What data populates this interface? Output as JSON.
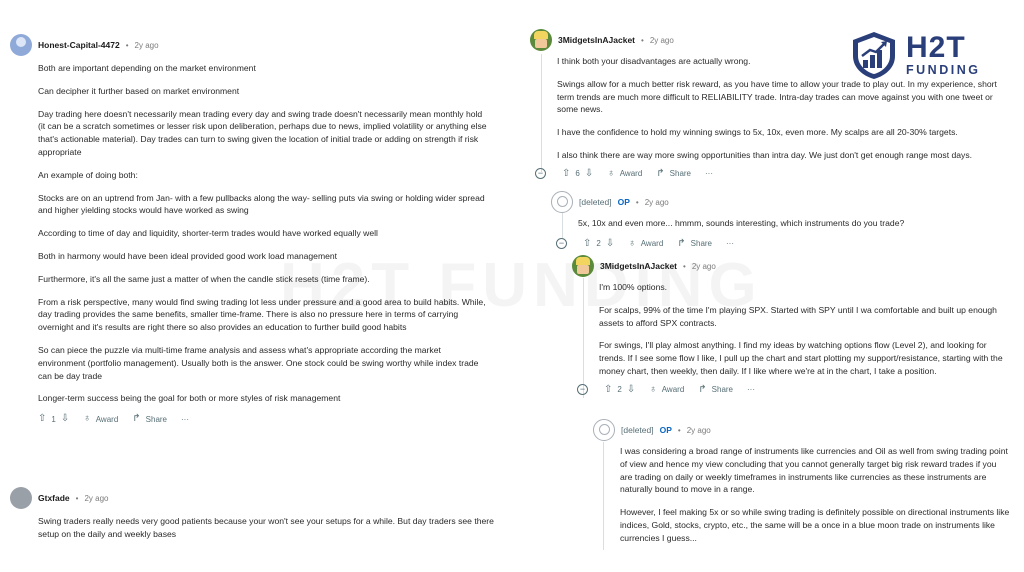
{
  "watermark": "H2T FUNDING",
  "logo": {
    "main": "H2T",
    "sub": "FUNDING"
  },
  "actions": {
    "award": "Award",
    "share": "Share",
    "more": "···"
  },
  "c1": {
    "author": "Honest-Capital-4472",
    "age": "2y ago",
    "paragraphs": [
      "Both are important depending on the market environment",
      "Can decipher it further based on market environment",
      "Day trading here doesn't necessarily mean trading every day and swing trade doesn't necessarily mean monthly hold (it can be a scratch sometimes or lesser risk upon deliberation, perhaps due to news, implied volatility or anything else that's actionable material). Day trades can turn to swing given the location of initial trade or adding on strength if risk appropriate",
      "An example of doing both:",
      "Stocks are on an uptrend from Jan- with a few pullbacks along the way- selling puts via swing or holding wider spread and higher yielding stocks would have worked as swing",
      "According to time of day and liquidity, shorter-term trades would have worked equally well",
      "Both in harmony would have been ideal provided good work load management",
      "Furthermore, it's all the same just a matter of when the candle stick resets (time frame).",
      "From a risk perspective, many would find swing trading lot less under pressure and a good area to build habits. While, day trading provides the same benefits, smaller time-frame. There is also no pressure here in terms of carrying overnight and it's results are right there so also provides an education to further build good habits",
      "So can piece the puzzle via multi-time frame analysis and assess what's appropriate according the market environment (portfolio management). Usually both is the answer. One stock could be swing worthy while index trade can be day trade",
      "Longer-term success being the goal for both or more styles of risk management"
    ],
    "votes": "1"
  },
  "c2": {
    "author": "Gtxfade",
    "age": "2y ago",
    "paragraphs": [
      "Swing traders really needs very good patients because your won't see your setups for a while. But day traders see there setup on the daily and weekly bases"
    ]
  },
  "c3": {
    "author": "3MidgetsInAJacket",
    "age": "2y ago",
    "paragraphs": [
      "I think both your disadvantages are actually wrong.",
      "Swings allow for a much better risk reward, as you have time to allow your trade to play out. In my experience, short term trends are much more difficult to RELIABILITY trade. Intra-day trades can move against you with one tweet or some news.",
      "I have the confidence to hold my winning swings to 5x, 10x, even more. My scalps are all 20-30% targets.",
      "I also think there are way more swing opportunities than intra day. We just don't get enough range most days."
    ],
    "votes": "6"
  },
  "c4": {
    "author": "[deleted]",
    "op": "OP",
    "age": "2y ago",
    "paragraphs": [
      "5x, 10x and even more... hmmm, sounds interesting, which instruments do you trade?"
    ],
    "votes": "2"
  },
  "c5": {
    "author": "3MidgetsInAJacket",
    "age": "2y ago",
    "paragraphs": [
      "I'm 100% options.",
      "For scalps, 99% of the time I'm playing SPX. Started with SPY until I wa comfortable and built up enough assets to afford SPX contracts.",
      "For swings, I'll play almost anything. I find my ideas by watching options flow (Level 2), and looking for trends. If I see some flow I like, I pull up the chart and start plotting my support/resistance, starting with the money chart, then weekly, then daily. If I like where we're at in the chart, I take a position."
    ],
    "votes": "2"
  },
  "c6": {
    "author": "[deleted]",
    "op": "OP",
    "age": "2y ago",
    "paragraphs": [
      "I was considering a broad range of instruments like currencies and Oil as well from swing trading point of view and hence my view concluding that you cannot generally target big risk reward trades if you are trading on daily or weekly timeframes in instruments like currencies as these instruments are naturally bound to move in a range.",
      "However, I feel making 5x or so while swing trading is definitely possible on directional instruments like indices, Gold, stocks, crypto, etc., the same will be a once in a blue moon trade on instruments like currencies I guess..."
    ]
  }
}
